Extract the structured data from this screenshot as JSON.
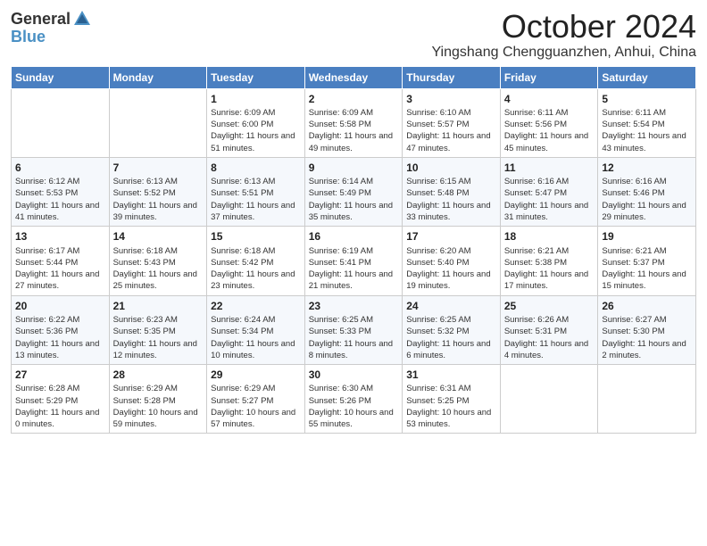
{
  "header": {
    "logo_general": "General",
    "logo_blue": "Blue",
    "month_title": "October 2024",
    "location": "Yingshang Chengguanzhen, Anhui, China"
  },
  "weekdays": [
    "Sunday",
    "Monday",
    "Tuesday",
    "Wednesday",
    "Thursday",
    "Friday",
    "Saturday"
  ],
  "weeks": [
    [
      {
        "day": "",
        "sunrise": "",
        "sunset": "",
        "daylight": ""
      },
      {
        "day": "",
        "sunrise": "",
        "sunset": "",
        "daylight": ""
      },
      {
        "day": "1",
        "sunrise": "Sunrise: 6:09 AM",
        "sunset": "Sunset: 6:00 PM",
        "daylight": "Daylight: 11 hours and 51 minutes."
      },
      {
        "day": "2",
        "sunrise": "Sunrise: 6:09 AM",
        "sunset": "Sunset: 5:58 PM",
        "daylight": "Daylight: 11 hours and 49 minutes."
      },
      {
        "day": "3",
        "sunrise": "Sunrise: 6:10 AM",
        "sunset": "Sunset: 5:57 PM",
        "daylight": "Daylight: 11 hours and 47 minutes."
      },
      {
        "day": "4",
        "sunrise": "Sunrise: 6:11 AM",
        "sunset": "Sunset: 5:56 PM",
        "daylight": "Daylight: 11 hours and 45 minutes."
      },
      {
        "day": "5",
        "sunrise": "Sunrise: 6:11 AM",
        "sunset": "Sunset: 5:54 PM",
        "daylight": "Daylight: 11 hours and 43 minutes."
      }
    ],
    [
      {
        "day": "6",
        "sunrise": "Sunrise: 6:12 AM",
        "sunset": "Sunset: 5:53 PM",
        "daylight": "Daylight: 11 hours and 41 minutes."
      },
      {
        "day": "7",
        "sunrise": "Sunrise: 6:13 AM",
        "sunset": "Sunset: 5:52 PM",
        "daylight": "Daylight: 11 hours and 39 minutes."
      },
      {
        "day": "8",
        "sunrise": "Sunrise: 6:13 AM",
        "sunset": "Sunset: 5:51 PM",
        "daylight": "Daylight: 11 hours and 37 minutes."
      },
      {
        "day": "9",
        "sunrise": "Sunrise: 6:14 AM",
        "sunset": "Sunset: 5:49 PM",
        "daylight": "Daylight: 11 hours and 35 minutes."
      },
      {
        "day": "10",
        "sunrise": "Sunrise: 6:15 AM",
        "sunset": "Sunset: 5:48 PM",
        "daylight": "Daylight: 11 hours and 33 minutes."
      },
      {
        "day": "11",
        "sunrise": "Sunrise: 6:16 AM",
        "sunset": "Sunset: 5:47 PM",
        "daylight": "Daylight: 11 hours and 31 minutes."
      },
      {
        "day": "12",
        "sunrise": "Sunrise: 6:16 AM",
        "sunset": "Sunset: 5:46 PM",
        "daylight": "Daylight: 11 hours and 29 minutes."
      }
    ],
    [
      {
        "day": "13",
        "sunrise": "Sunrise: 6:17 AM",
        "sunset": "Sunset: 5:44 PM",
        "daylight": "Daylight: 11 hours and 27 minutes."
      },
      {
        "day": "14",
        "sunrise": "Sunrise: 6:18 AM",
        "sunset": "Sunset: 5:43 PM",
        "daylight": "Daylight: 11 hours and 25 minutes."
      },
      {
        "day": "15",
        "sunrise": "Sunrise: 6:18 AM",
        "sunset": "Sunset: 5:42 PM",
        "daylight": "Daylight: 11 hours and 23 minutes."
      },
      {
        "day": "16",
        "sunrise": "Sunrise: 6:19 AM",
        "sunset": "Sunset: 5:41 PM",
        "daylight": "Daylight: 11 hours and 21 minutes."
      },
      {
        "day": "17",
        "sunrise": "Sunrise: 6:20 AM",
        "sunset": "Sunset: 5:40 PM",
        "daylight": "Daylight: 11 hours and 19 minutes."
      },
      {
        "day": "18",
        "sunrise": "Sunrise: 6:21 AM",
        "sunset": "Sunset: 5:38 PM",
        "daylight": "Daylight: 11 hours and 17 minutes."
      },
      {
        "day": "19",
        "sunrise": "Sunrise: 6:21 AM",
        "sunset": "Sunset: 5:37 PM",
        "daylight": "Daylight: 11 hours and 15 minutes."
      }
    ],
    [
      {
        "day": "20",
        "sunrise": "Sunrise: 6:22 AM",
        "sunset": "Sunset: 5:36 PM",
        "daylight": "Daylight: 11 hours and 13 minutes."
      },
      {
        "day": "21",
        "sunrise": "Sunrise: 6:23 AM",
        "sunset": "Sunset: 5:35 PM",
        "daylight": "Daylight: 11 hours and 12 minutes."
      },
      {
        "day": "22",
        "sunrise": "Sunrise: 6:24 AM",
        "sunset": "Sunset: 5:34 PM",
        "daylight": "Daylight: 11 hours and 10 minutes."
      },
      {
        "day": "23",
        "sunrise": "Sunrise: 6:25 AM",
        "sunset": "Sunset: 5:33 PM",
        "daylight": "Daylight: 11 hours and 8 minutes."
      },
      {
        "day": "24",
        "sunrise": "Sunrise: 6:25 AM",
        "sunset": "Sunset: 5:32 PM",
        "daylight": "Daylight: 11 hours and 6 minutes."
      },
      {
        "day": "25",
        "sunrise": "Sunrise: 6:26 AM",
        "sunset": "Sunset: 5:31 PM",
        "daylight": "Daylight: 11 hours and 4 minutes."
      },
      {
        "day": "26",
        "sunrise": "Sunrise: 6:27 AM",
        "sunset": "Sunset: 5:30 PM",
        "daylight": "Daylight: 11 hours and 2 minutes."
      }
    ],
    [
      {
        "day": "27",
        "sunrise": "Sunrise: 6:28 AM",
        "sunset": "Sunset: 5:29 PM",
        "daylight": "Daylight: 11 hours and 0 minutes."
      },
      {
        "day": "28",
        "sunrise": "Sunrise: 6:29 AM",
        "sunset": "Sunset: 5:28 PM",
        "daylight": "Daylight: 10 hours and 59 minutes."
      },
      {
        "day": "29",
        "sunrise": "Sunrise: 6:29 AM",
        "sunset": "Sunset: 5:27 PM",
        "daylight": "Daylight: 10 hours and 57 minutes."
      },
      {
        "day": "30",
        "sunrise": "Sunrise: 6:30 AM",
        "sunset": "Sunset: 5:26 PM",
        "daylight": "Daylight: 10 hours and 55 minutes."
      },
      {
        "day": "31",
        "sunrise": "Sunrise: 6:31 AM",
        "sunset": "Sunset: 5:25 PM",
        "daylight": "Daylight: 10 hours and 53 minutes."
      },
      {
        "day": "",
        "sunrise": "",
        "sunset": "",
        "daylight": ""
      },
      {
        "day": "",
        "sunrise": "",
        "sunset": "",
        "daylight": ""
      }
    ]
  ]
}
